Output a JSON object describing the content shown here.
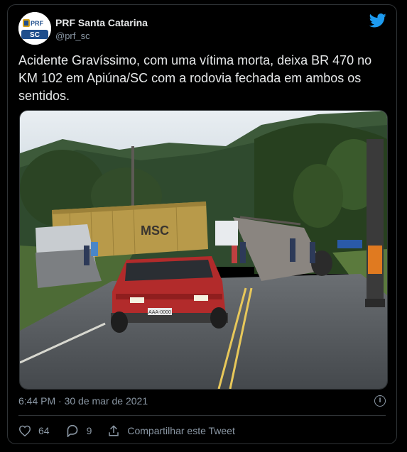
{
  "author": {
    "name": "PRF Santa Catarina",
    "handle": "@prf_sc",
    "avatar_top_text": "PRF",
    "avatar_bottom_text": "SC"
  },
  "tweet": {
    "text": "Acidente Gravíssimo, com uma vítima morta, deixa BR 470 no KM 102 em Apiúna/SC com a rodovia fechada em ambos os sentidos.",
    "timestamp": "6:44 PM · 30 de mar de 2021",
    "media": {
      "container_label": "MSC",
      "car_plate": "AAA-0000"
    }
  },
  "actions": {
    "likes": "64",
    "replies": "9",
    "share_label": "Compartilhar este Tweet"
  },
  "colors": {
    "twitter_blue": "#1d9bf0",
    "background": "#000000",
    "border": "#2f3336",
    "muted_text": "#8b98a5"
  },
  "icons": [
    "twitter-bird-icon",
    "info-icon",
    "heart-icon",
    "reply-icon",
    "share-icon"
  ]
}
